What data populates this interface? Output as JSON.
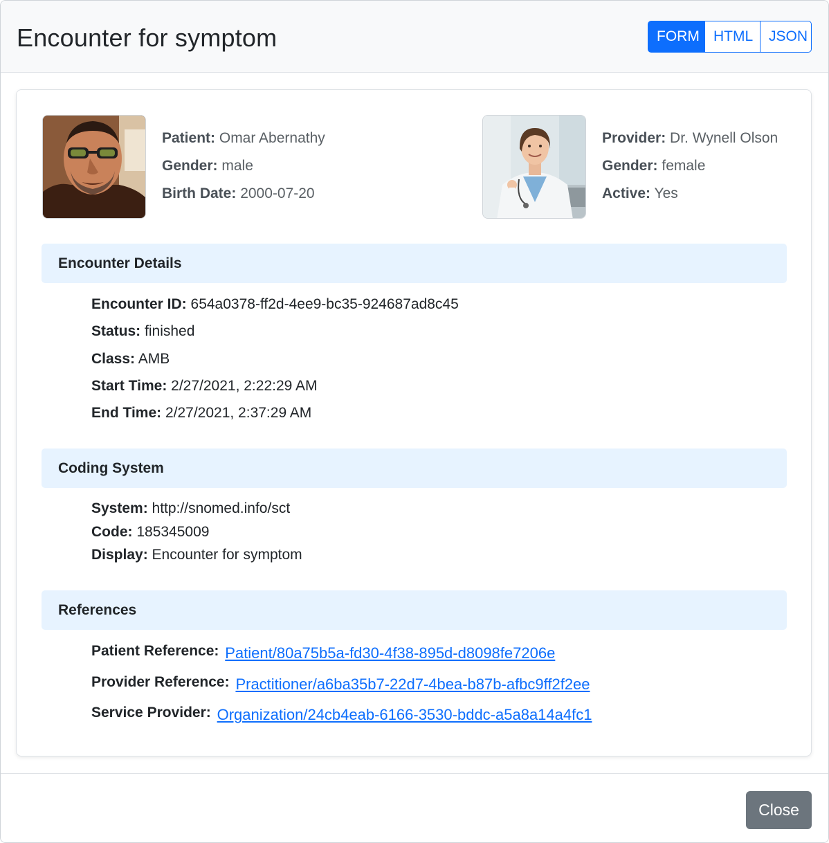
{
  "modal": {
    "title": "Encounter for symptom",
    "view_tabs": [
      {
        "label": "FORM",
        "active": true
      },
      {
        "label": "HTML",
        "active": false
      },
      {
        "label": "JSON",
        "active": false
      }
    ],
    "close_label": "Close"
  },
  "patient": {
    "name_label": "Patient:",
    "name": "Omar Abernathy",
    "gender_label": "Gender:",
    "gender": "male",
    "birth_label": "Birth Date:",
    "birth_date": "2000-07-20"
  },
  "provider": {
    "name_label": "Provider:",
    "name": "Dr. Wynell Olson",
    "gender_label": "Gender:",
    "gender": "female",
    "active_label": "Active:",
    "active": "Yes"
  },
  "encounter_details": {
    "heading": "Encounter Details",
    "fields": [
      {
        "label": "Encounter ID:",
        "value": "654a0378-ff2d-4ee9-bc35-924687ad8c45"
      },
      {
        "label": "Status:",
        "value": "finished"
      },
      {
        "label": "Class:",
        "value": "AMB"
      },
      {
        "label": "Start Time:",
        "value": "2/27/2021, 2:22:29 AM"
      },
      {
        "label": "End Time:",
        "value": "2/27/2021, 2:37:29 AM"
      }
    ]
  },
  "coding_system": {
    "heading": "Coding System",
    "fields": [
      {
        "label": "System:",
        "value": "http://snomed.info/sct"
      },
      {
        "label": "Code:",
        "value": "185345009"
      },
      {
        "label": "Display:",
        "value": "Encounter for symptom"
      }
    ]
  },
  "references": {
    "heading": "References",
    "fields": [
      {
        "label": "Patient Reference:",
        "value": "Patient/80a75b5a-fd30-4f38-895d-d8098fe7206e"
      },
      {
        "label": "Provider Reference:",
        "value": "Practitioner/a6ba35b7-22d7-4bea-b87b-afbc9ff2f2ee"
      },
      {
        "label": "Service Provider:",
        "value": "Organization/24cb4eab-6166-3530-bddc-a5a8a14a4fc1"
      }
    ]
  },
  "colors": {
    "primary": "#0d6efd",
    "section_bg": "#e7f3ff",
    "close_button": "#6c757d",
    "header_bg": "#f8f9fa"
  }
}
